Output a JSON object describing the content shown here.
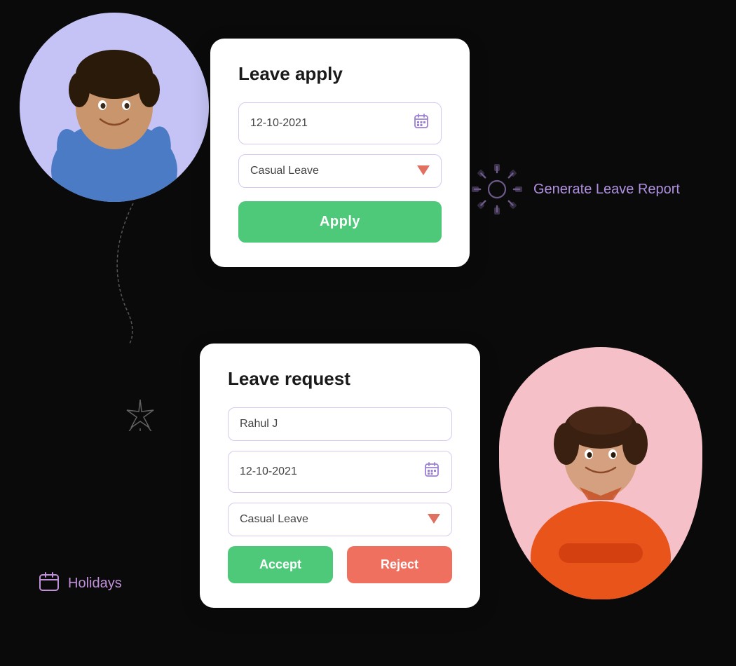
{
  "top_card": {
    "title": "Leave apply",
    "date_value": "12-10-2021",
    "leave_type": "Casual Leave",
    "apply_button": "Apply"
  },
  "bottom_card": {
    "title": "Leave request",
    "employee_name": "Rahul J",
    "date_value": "12-10-2021",
    "leave_type": "Casual Leave",
    "accept_button": "Accept",
    "reject_button": "Reject"
  },
  "generate_report": {
    "label": "Generate Leave Report"
  },
  "holidays": {
    "label": "Holidays"
  },
  "colors": {
    "blue_bg": "#c5c3f5",
    "pink_bg": "#f5c0c8",
    "apply_btn": "#4ec97a",
    "accept_btn": "#4ec97a",
    "reject_btn": "#f07060",
    "report_text": "#b090e0",
    "holidays_text": "#c090d8",
    "field_border": "#d8c8f0"
  }
}
